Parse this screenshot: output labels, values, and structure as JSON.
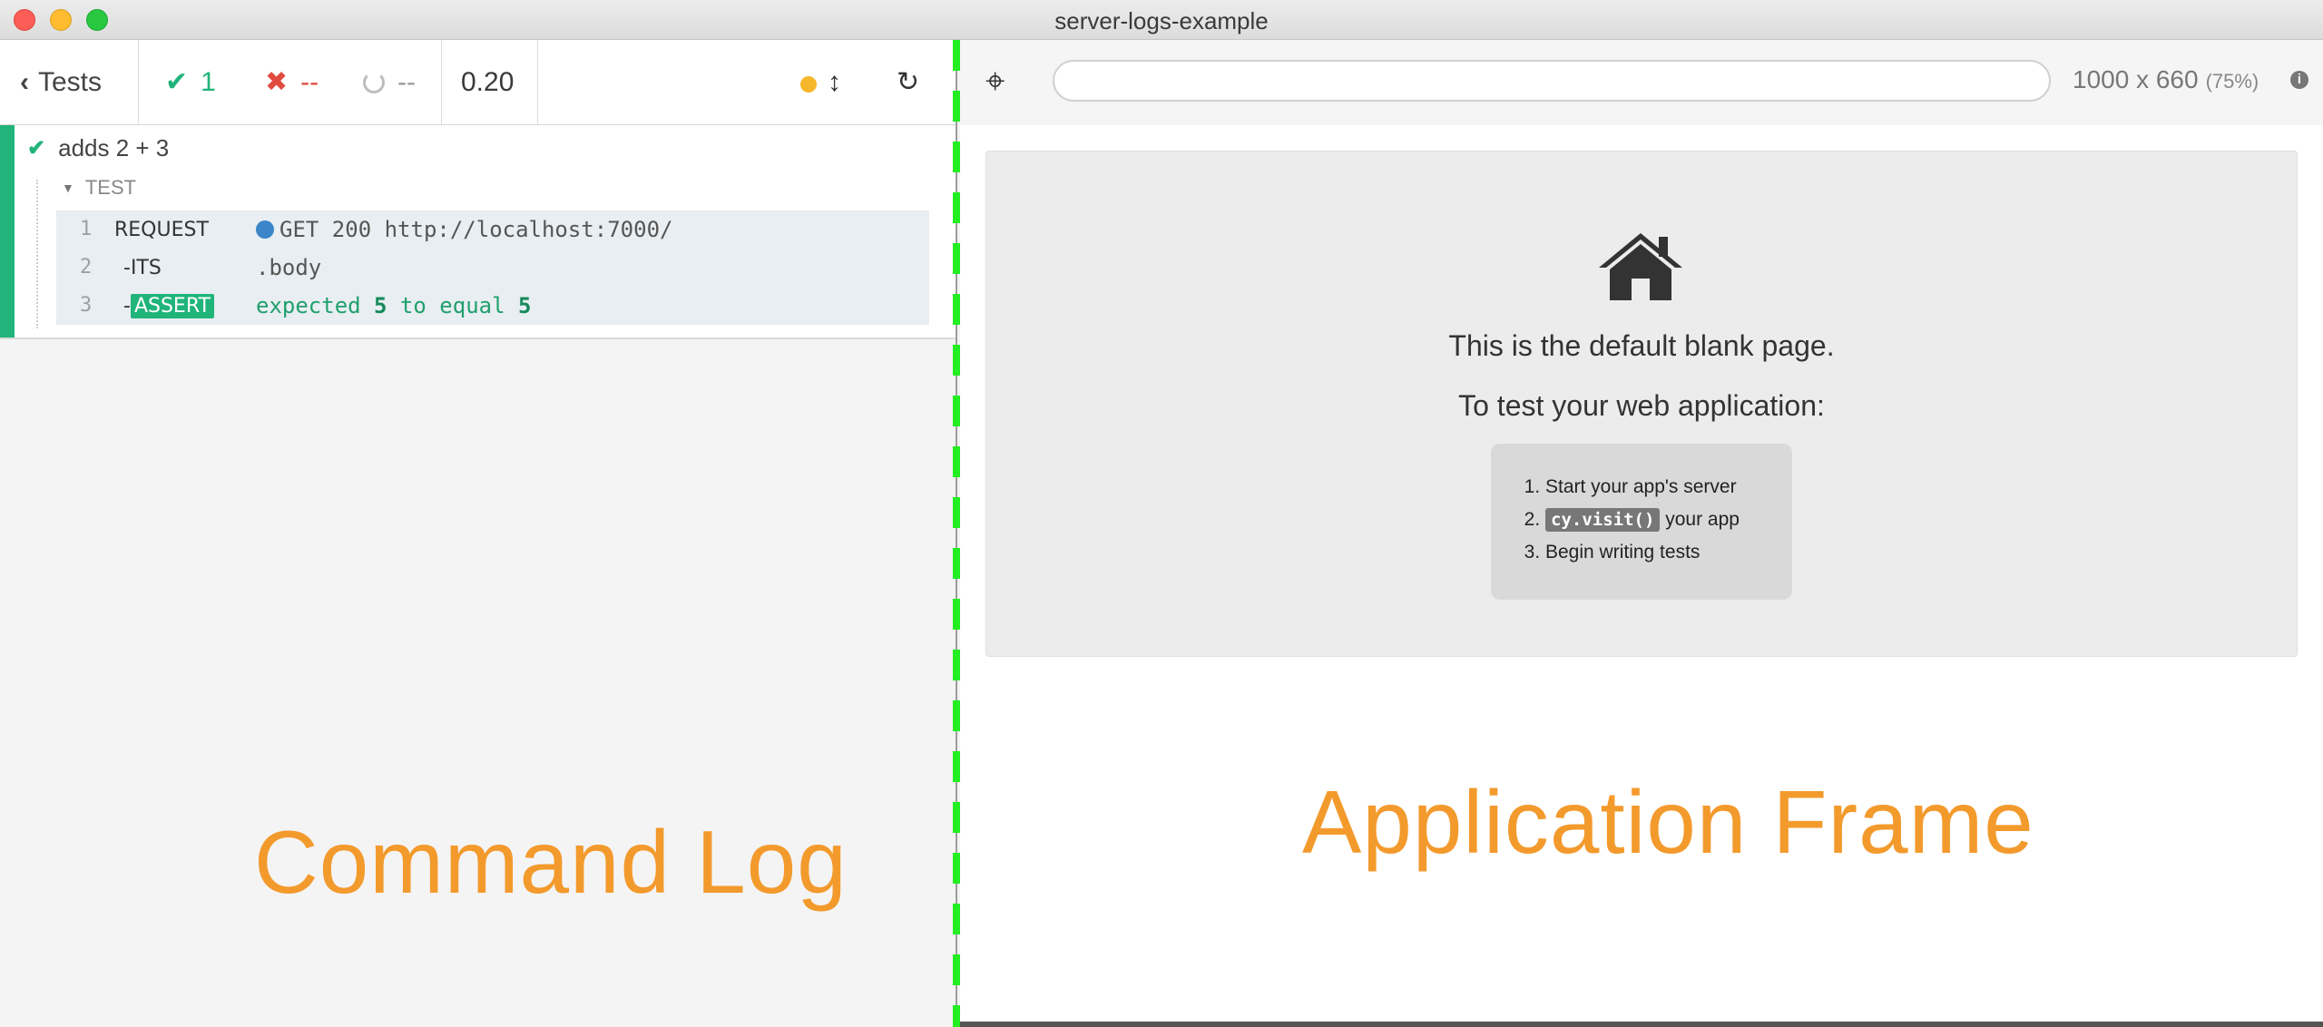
{
  "window": {
    "title": "server-logs-example"
  },
  "reporter": {
    "tests_label": "Tests",
    "stats": {
      "passed": "1",
      "failed": "--",
      "pending": "--"
    },
    "duration": "0.20",
    "test": {
      "title": "adds 2 + 3",
      "hook_label": "TEST",
      "commands": [
        {
          "num": "1",
          "name": "REQUEST",
          "message": "GET 200 http://localhost:7000/"
        },
        {
          "num": "2",
          "name": "-ITS",
          "message": ".body"
        },
        {
          "num": "3",
          "prefix": "-",
          "name": "ASSERT",
          "msg_pre": "expected ",
          "msg_v1": "5",
          "msg_mid": " to equal ",
          "msg_v2": "5"
        }
      ]
    },
    "overlay_label": "Command Log"
  },
  "runner": {
    "url": "",
    "viewport": "1000 x 660",
    "scale": "(75%)",
    "info": "i",
    "blank_page": {
      "line1": "This is the default blank page.",
      "line2": "To test your web application:",
      "steps": [
        "Start your app's server",
        "cy.visit()",
        " your app",
        "Begin writing tests"
      ]
    },
    "overlay_label": "Application Frame"
  },
  "colors": {
    "pass": "#20b47a",
    "fail": "#e04b3f",
    "overlay": "#f39a2d",
    "divider": "#22ee22",
    "request_dot": "#3a86c8"
  },
  "icons": [
    "close-icon",
    "minimize-icon",
    "maximize-icon",
    "chevron-left-icon",
    "check-icon",
    "x-icon",
    "spinner-icon",
    "resize-icon",
    "reload-icon",
    "crosshair-icon",
    "info-icon",
    "home-icon"
  ]
}
